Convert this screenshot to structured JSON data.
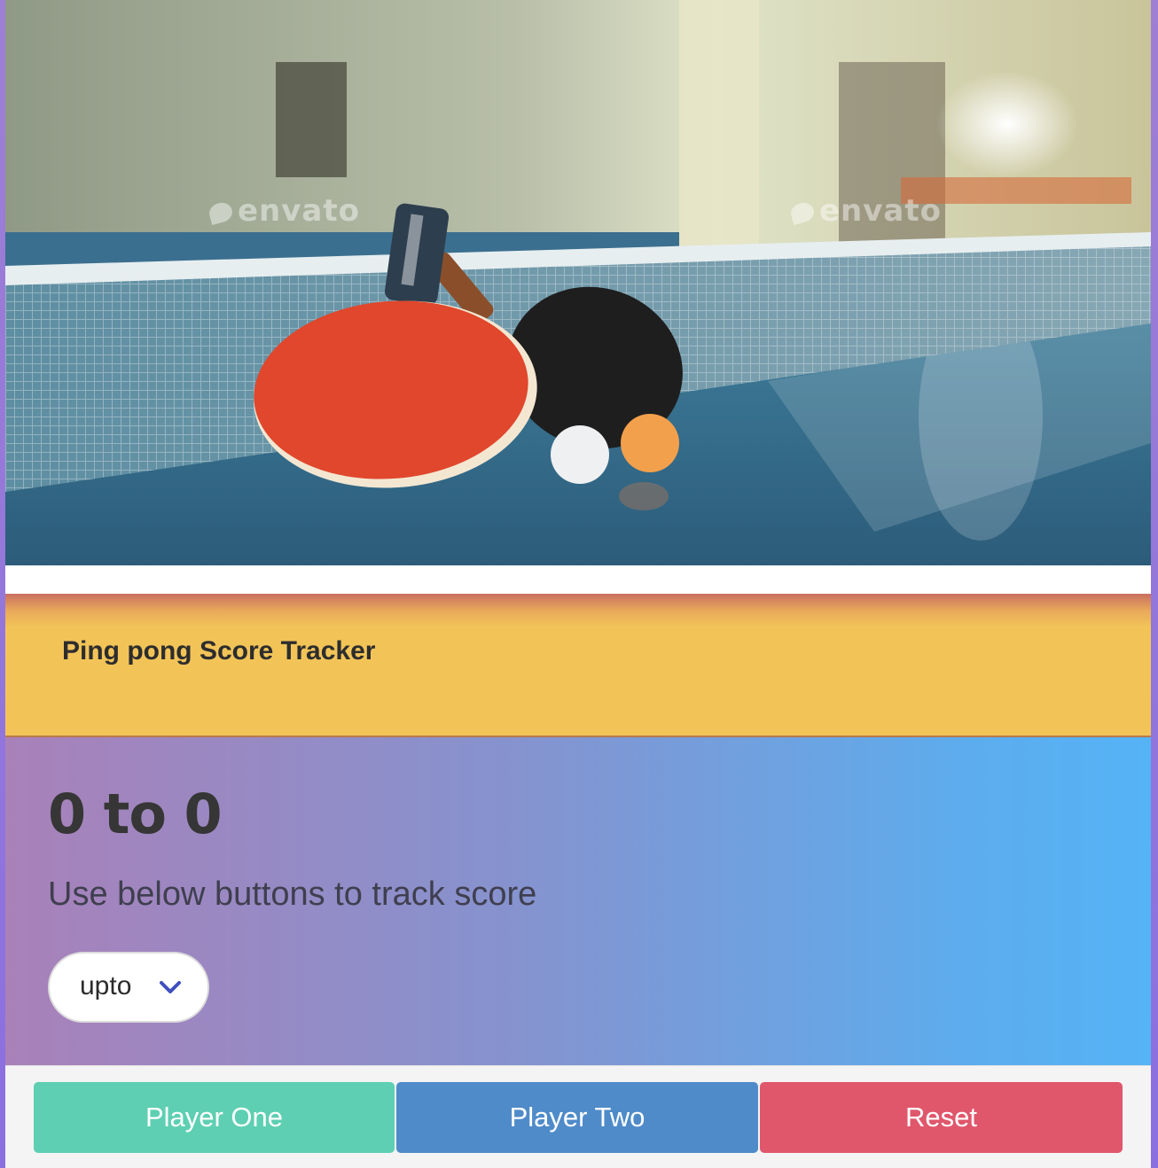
{
  "hero": {
    "watermarks": [
      "envato",
      "envato"
    ]
  },
  "header": {
    "title": "Ping pong Score Tracker"
  },
  "score": {
    "text": "0 to 0",
    "instructions": "Use below buttons to track score",
    "select_value": "upto"
  },
  "footer": {
    "player_one_label": "Player One",
    "player_two_label": "Player Two",
    "reset_label": "Reset"
  },
  "colors": {
    "header_band": "#f2c458",
    "player_one": "#5ecfb2",
    "player_two": "#4f8bc9",
    "reset": "#e0576c",
    "chevron": "#3f4fbf"
  }
}
